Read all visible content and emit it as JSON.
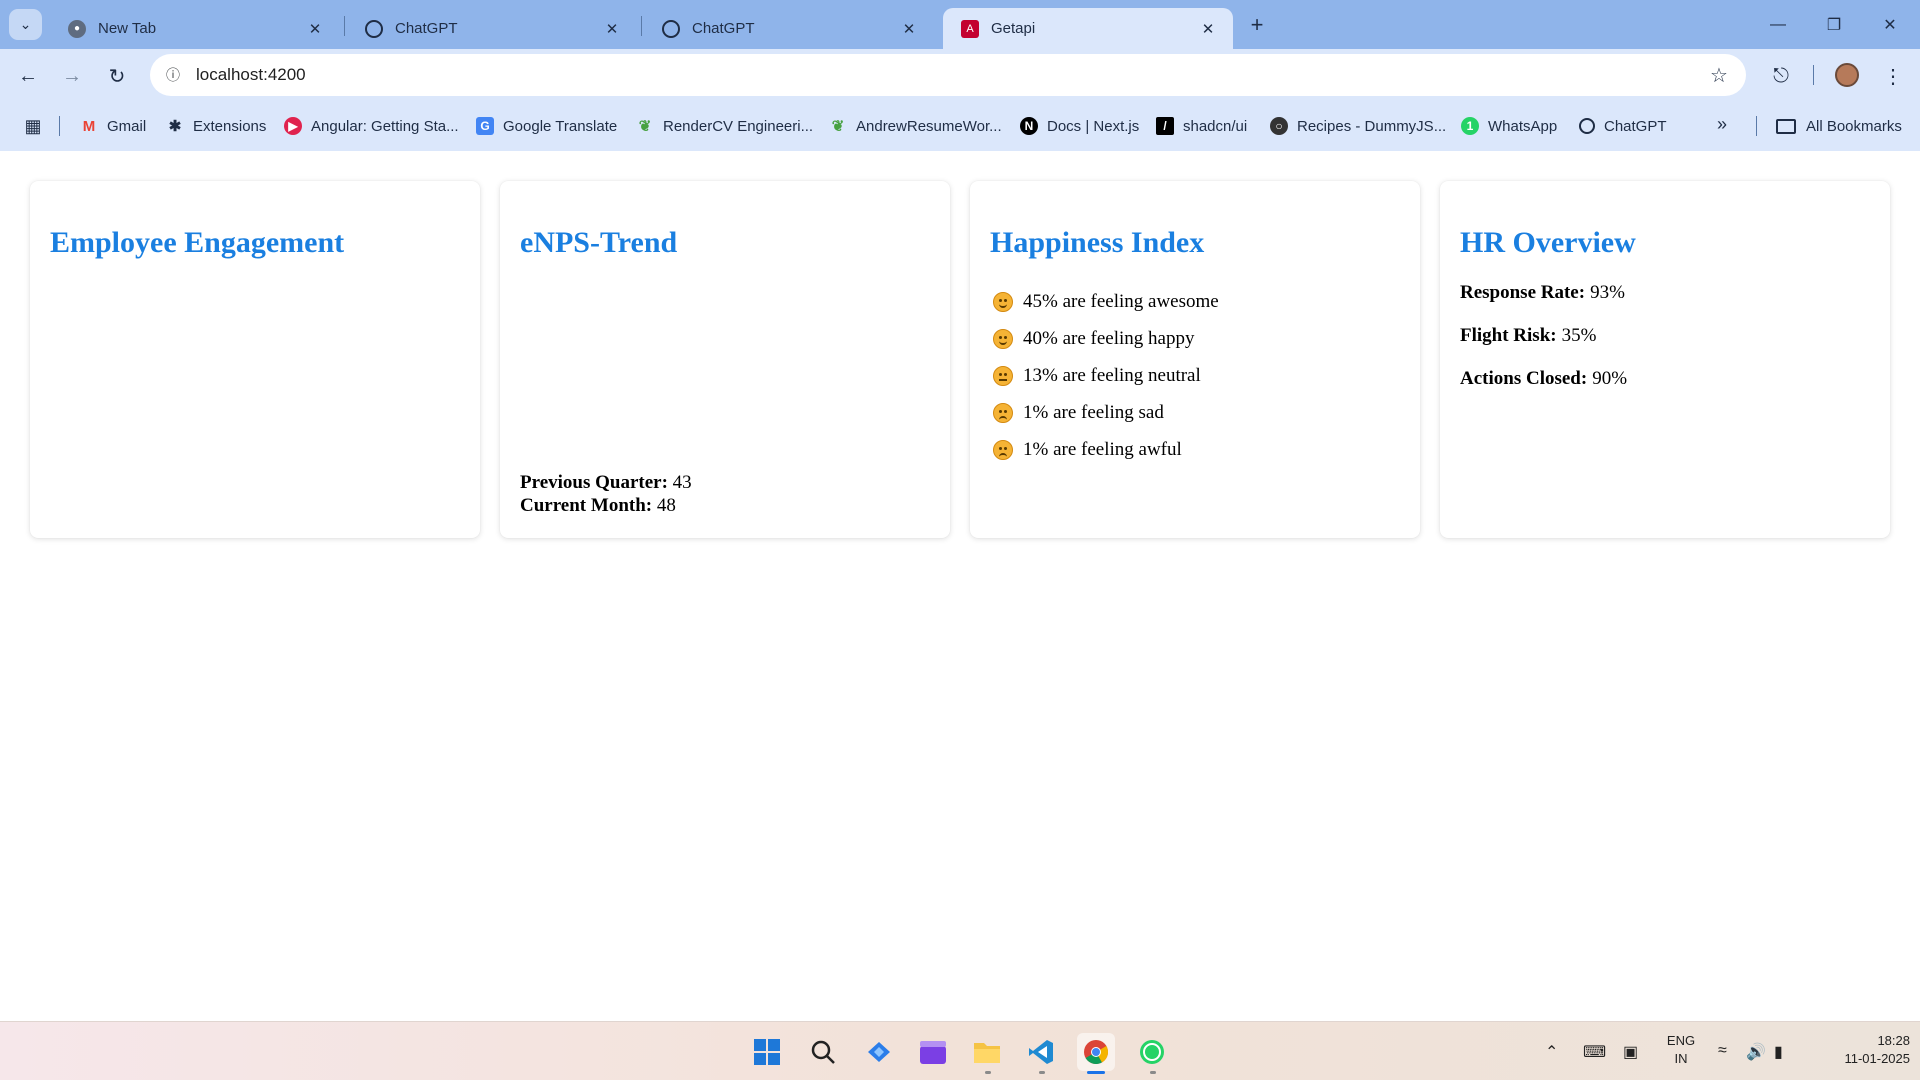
{
  "browser": {
    "tabs": [
      {
        "title": "New Tab",
        "icon": "chrome-icon"
      },
      {
        "title": "ChatGPT",
        "icon": "openai-icon"
      },
      {
        "title": "ChatGPT",
        "icon": "openai-icon"
      },
      {
        "title": "Getapi",
        "icon": "angular-icon"
      }
    ],
    "url": "localhost:4200",
    "bookmarks": [
      {
        "label": "Gmail",
        "icon": "gmail-icon"
      },
      {
        "label": "Extensions",
        "icon": "puzzle-icon"
      },
      {
        "label": "Angular: Getting Sta...",
        "icon": "angular-icon"
      },
      {
        "label": "Google Translate",
        "icon": "translate-icon"
      },
      {
        "label": "RenderCV Engineeri...",
        "icon": "overleaf-icon"
      },
      {
        "label": "AndrewResumeWor...",
        "icon": "overleaf-icon"
      },
      {
        "label": "Docs | Next.js",
        "icon": "nextjs-icon"
      },
      {
        "label": "shadcn/ui",
        "icon": "shadcn-icon"
      },
      {
        "label": "Recipes - DummyJS...",
        "icon": "dummyjson-icon"
      },
      {
        "label": "WhatsApp",
        "icon": "whatsapp-icon"
      },
      {
        "label": "ChatGPT",
        "icon": "openai-icon"
      }
    ],
    "all_bookmarks": "All Bookmarks"
  },
  "dashboard": {
    "engagement": {
      "title": "Employee Engagement"
    },
    "enps": {
      "title": "eNPS-Trend",
      "prev_label": "Previous Quarter:",
      "prev_value": "43",
      "curr_label": "Current Month:",
      "curr_value": "48"
    },
    "happiness": {
      "title": "Happiness Index",
      "moods": [
        {
          "text": "45% are feeling awesome",
          "face": "smile"
        },
        {
          "text": "40% are feeling happy",
          "face": "smile"
        },
        {
          "text": "13% are feeling neutral",
          "face": "flat"
        },
        {
          "text": "1% are feeling sad",
          "face": "sad"
        },
        {
          "text": "1% are feeling awful",
          "face": "sad"
        }
      ]
    },
    "hr": {
      "title": "HR Overview",
      "items": [
        {
          "label": "Response Rate:",
          "value": "93%"
        },
        {
          "label": "Flight Risk:",
          "value": "35%"
        },
        {
          "label": "Actions Closed:",
          "value": "90%"
        }
      ]
    }
  },
  "taskbar": {
    "apps": [
      "windows-start-icon",
      "search-icon",
      "azure-devops-icon",
      "clipchamp-icon",
      "file-explorer-icon",
      "vscode-icon",
      "chrome-icon",
      "whatsapp-icon"
    ],
    "lang_1": "ENG",
    "lang_2": "IN",
    "time": "18:28",
    "date": "11-01-2025"
  },
  "colors": {
    "accent": "#1a7fe0",
    "tabstrip": "#8fb4ea",
    "toolbar": "#dbe7fb"
  }
}
